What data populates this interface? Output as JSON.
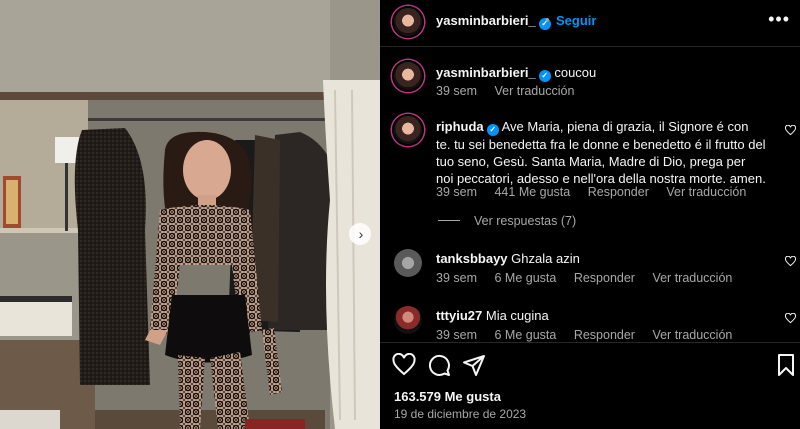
{
  "post": {
    "author": "yasminbarbieri_",
    "follow_label": "Seguir",
    "separator": "•",
    "more_label": "•••",
    "next_label": "›"
  },
  "caption": {
    "username": "yasminbarbieri_",
    "text": "coucou",
    "time": "39 sem",
    "translate": "Ver traducción"
  },
  "comments": [
    {
      "username": "riphuda",
      "verified": true,
      "text": "Ave Maria, piena di grazia, il Signore é con te. tu sei benedetta fra le donne e benedetto é il frutto del tuo seno, Gesù. Santa Maria, Madre di Dio, prega per noi peccatori, adesso e nell'ora della nostra morte. amen.",
      "time": "39 sem",
      "likes": "441 Me gusta",
      "reply": "Responder",
      "translate": "Ver traducción",
      "view_replies": "Ver respuestas (7)"
    },
    {
      "username": "tanksbbayy",
      "verified": false,
      "text": "Ghzala azin",
      "time": "39 sem",
      "likes": "6 Me gusta",
      "reply": "Responder",
      "translate": "Ver traducción"
    },
    {
      "username": "tttyiu27",
      "verified": false,
      "text": "Mia cugina",
      "time": "39 sem",
      "likes": "6 Me gusta",
      "reply": "Responder",
      "translate": "Ver traducción"
    }
  ],
  "footer": {
    "likes": "163.579 Me gusta",
    "date": "19 de diciembre de 2023"
  },
  "colors": {
    "accent": "#0095f6",
    "background": "#000000",
    "muted_text": "#a8a8a8",
    "divider": "#262626"
  },
  "icons": {
    "verified": "verified-badge-icon",
    "like": "heart-icon",
    "comment": "speech-bubble-icon",
    "share": "paper-plane-icon",
    "save": "bookmark-icon",
    "more": "ellipsis-icon",
    "next": "chevron-right-icon"
  }
}
